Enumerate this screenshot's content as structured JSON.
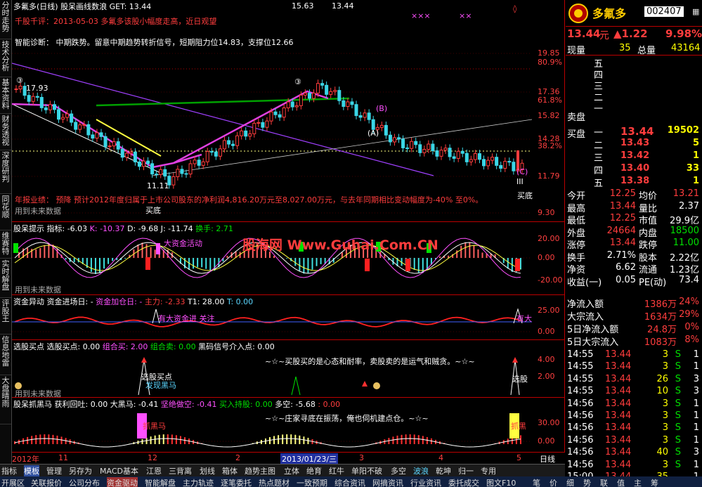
{
  "left_tabs": [
    "分时走势",
    "技术分析",
    "基本资料",
    "财务透视",
    "深度研判",
    "同花顺",
    "维赛特",
    "实时解盘",
    "评股王",
    "信息地雷",
    "大盘晴雨"
  ],
  "header": {
    "title": "多氟多(日线)",
    "indicator": "股呆画线数浪",
    "get_label": "GET: 13.44",
    "mid_value": "15.63",
    "right_value": "13.44"
  },
  "main_notes": {
    "line1": "千股千评：2013-05-03 多氟多该股小幅度走高，近日观望",
    "line2": "智能诊断： 中期跌势。留意中期趋势转折信号，短期阻力位14.83，支撑位12.66",
    "forecast": "年报业绩： 预降 预计2012年度归属于上市公司股东的净利润4,816.20万元至8,027.00万元，与去年同期相比变动幅度为-40% 至0%。",
    "future_data": "用到未来数据",
    "label_high": "17.93",
    "label_low": "11.11",
    "label_buy_bottom": "买底",
    "label_buy_bottom_right": "买底",
    "wave_A": "(A)",
    "wave_B": "(B)",
    "wave_C": "(C)",
    "wave_3a": "③",
    "wave_3b": "③",
    "wave_III": "III",
    "xxx": "×××",
    "xx2": "××"
  },
  "main_axis": {
    "ticks": [
      "19.85",
      "80.9%",
      "17.36",
      "61.8%",
      "15.82",
      "14.28",
      "38.2%",
      "11.79",
      "9.30"
    ],
    "ticks_full": [
      "19.85",
      "80.9%",
      "17.36",
      "61.8%",
      "15.82",
      "14.28",
      "38.2%",
      "11.79",
      "9.30"
    ]
  },
  "pane2": {
    "title": "股呆提示 指标: -6.03",
    "k": "K: -10.37",
    "d": "D: -9.68",
    "j": "J: -11.74",
    "turnover": "换手: 2.71",
    "event": "大资金活动",
    "watermark": "股海网 Www.Guhai.Com.CN",
    "future_data": "用到未来数据",
    "ticks": [
      "20.00",
      "0.00",
      "-20.00"
    ],
    "buy": "卖",
    "sell": "买"
  },
  "pane3": {
    "title": "资金异动",
    "a": "资金进场日: -",
    "b": "资金加仓日: -",
    "c": "主力: -2.33",
    "d": "T1: 28.00",
    "e": "T: 0.00",
    "event": "有大资金进 关注",
    "event_right": "有大",
    "ticks": [
      "25.00",
      "0.00"
    ]
  },
  "pane4": {
    "title": "选股买点",
    "a": "选股买点: 0.00",
    "b": "组合买: 2.00",
    "c": "组合卖: 0.00",
    "d": "黑码信号介入点: 0.00",
    "quote": "~☆~买股买的是心态和耐率，卖股卖的是运气和贼贪。~☆~",
    "buy_point": "选股买点",
    "black_horse": "发现黑马",
    "future_data": "用到未来数据",
    "buy_right": "选股",
    "ticks": [
      "4.00",
      "2.00"
    ]
  },
  "pane5": {
    "title": "股呆抓黑马",
    "a": "获利回吐: 0.00",
    "b": "大黑马: -0.41",
    "c": "坚绝做空: -0.41",
    "d": "买入持股: 0.00",
    "e": "多空: -5.68",
    "f": ": 0.00",
    "quote": "~☆~庄家寻底在振荡，俺也伺机建点仓。~☆~",
    "horse": "抓黑马",
    "horse_right": "抓黑",
    "ticks": [
      "30.00",
      "0.00"
    ]
  },
  "date_axis": {
    "labels": [
      "2012年",
      "11",
      "12",
      "2",
      "2013/01/23/三",
      "3",
      "4",
      "5"
    ],
    "mode": "日线"
  },
  "tabbar": [
    "指标",
    "模板",
    "管理",
    "另存为",
    "MACD基本",
    "江恩",
    "三背离",
    "划线",
    "箱体",
    "趋势主图",
    "立体",
    "绝育",
    "红牛",
    "单阳不破",
    "多空",
    "波浪",
    "乾坤",
    "归一",
    "专用"
  ],
  "bottombar": [
    "开展区",
    "关联报价",
    "公司分布",
    "资金驱动",
    "智能解盘",
    "主力轨迹",
    "逐笔委托",
    "热点题材",
    "一致预期",
    "综合资讯",
    "网摘资讯",
    "行业资讯",
    "委托成交",
    "图文F10",
    "笔",
    "价",
    "细",
    "势",
    "联",
    "值",
    "主",
    "筹"
  ],
  "quote": {
    "name": "多氟多",
    "code": "002407",
    "price": "13.44",
    "unit": "元",
    "change": "▲1.22",
    "pct": "9.98%",
    "now_label": "现量",
    "now_val": "35",
    "total_label": "总量",
    "total_val": "43164",
    "sell_levels": [
      "五",
      "四",
      "三",
      "二",
      "一"
    ],
    "sell_label": "卖盘",
    "buy_label": "买盘",
    "buy_levels": [
      {
        "name": "一",
        "price": "13.44",
        "vol": "19502"
      },
      {
        "name": "二",
        "price": "13.43",
        "vol": "5"
      },
      {
        "name": "三",
        "price": "13.42",
        "vol": "1"
      },
      {
        "name": "四",
        "price": "13.40",
        "vol": "33"
      },
      {
        "name": "五",
        "price": "13.38",
        "vol": "1"
      }
    ],
    "stats": [
      {
        "l1": "今开",
        "v1": "12.25",
        "l2": "均价",
        "v2": "13.21"
      },
      {
        "l1": "最高",
        "v1": "13.44",
        "l2": "量比",
        "v2": "2.37"
      },
      {
        "l1": "最低",
        "v1": "12.25",
        "l2": "市值",
        "v2": "29.9亿"
      },
      {
        "l1": "外盘",
        "v1": "24664",
        "l2": "内盘",
        "v2": "18500"
      },
      {
        "l1": "涨停",
        "v1": "13.44",
        "l2": "跌停",
        "v2": "11.00"
      },
      {
        "l1": "换手",
        "v1": "2.71%",
        "l2": "股本",
        "v2": "2.22亿"
      },
      {
        "l1": "净资",
        "v1": "6.62",
        "l2": "流通",
        "v2": "1.23亿"
      },
      {
        "l1": "收益(一)",
        "v1": "0.05",
        "l2": "PE(动)",
        "v2": "73.4"
      }
    ],
    "flows": [
      {
        "label": "净流入额",
        "val": "1386万",
        "pct": "24%"
      },
      {
        "label": "大宗流入",
        "val": "1634万",
        "pct": "29%"
      },
      {
        "label": "5日净流入额",
        "val": "24.8万",
        "pct": "0%"
      },
      {
        "label": "5日大宗流入",
        "val": "1083万",
        "pct": "8%"
      }
    ],
    "ticks": [
      {
        "t": "14:55",
        "p": "13.44",
        "v": "3",
        "s": "S",
        "n": "1"
      },
      {
        "t": "14:55",
        "p": "13.44",
        "v": "3",
        "s": "S",
        "n": "1"
      },
      {
        "t": "14:55",
        "p": "13.44",
        "v": "26",
        "s": "S",
        "n": "3"
      },
      {
        "t": "14:55",
        "p": "13.44",
        "v": "10",
        "s": "S",
        "n": "3"
      },
      {
        "t": "14:56",
        "p": "13.44",
        "v": "3",
        "s": "S",
        "n": "1"
      },
      {
        "t": "14:56",
        "p": "13.44",
        "v": "3",
        "s": "S",
        "n": "1"
      },
      {
        "t": "14:56",
        "p": "13.44",
        "v": "3",
        "s": "S",
        "n": "1"
      },
      {
        "t": "14:56",
        "p": "13.44",
        "v": "3",
        "s": "S",
        "n": "1"
      },
      {
        "t": "14:56",
        "p": "13.44",
        "v": "40",
        "s": "S",
        "n": "3"
      },
      {
        "t": "14:56",
        "p": "13.44",
        "v": "3",
        "s": "S",
        "n": "1"
      },
      {
        "t": "15:00",
        "p": "13.44",
        "v": "35",
        "s": "",
        "n": "1"
      }
    ]
  },
  "colors": {
    "up": "#ff3d3d",
    "down": "#3ad6e6",
    "ma": "#ffffff",
    "grid": "#b00000",
    "accent": "#ffff00"
  }
}
